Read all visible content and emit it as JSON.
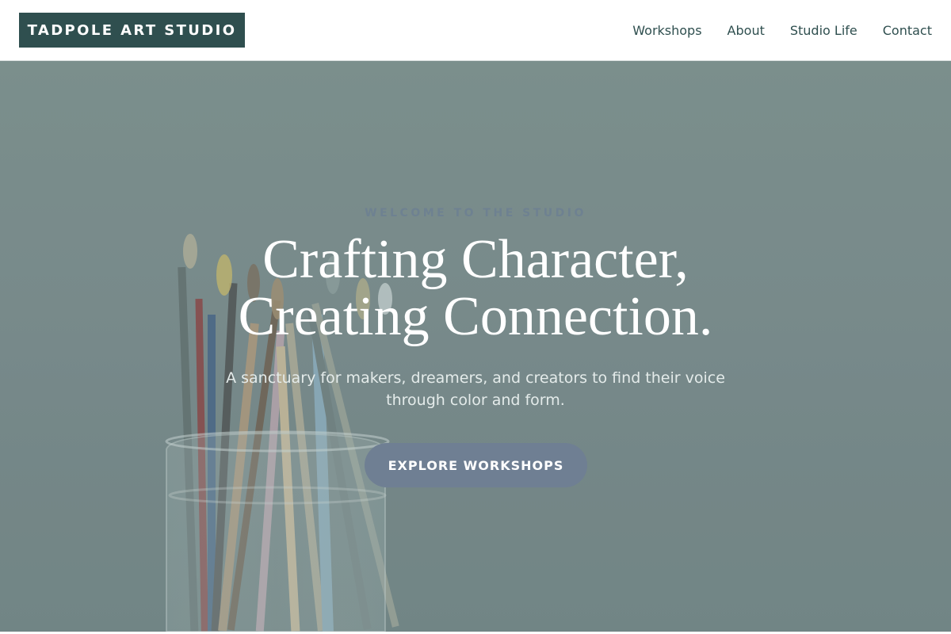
{
  "header": {
    "brand": "TADPOLE ART STUDIO",
    "nav": [
      {
        "label": "Workshops"
      },
      {
        "label": "About"
      },
      {
        "label": "Studio Life"
      },
      {
        "label": "Contact"
      }
    ]
  },
  "hero": {
    "eyebrow": "WELCOME TO THE STUDIO",
    "headline_line1": "Crafting Character,",
    "headline_line2": "Creating Connection.",
    "subtitle_line1": "A sanctuary for makers, dreamers, and creators to find their voice",
    "subtitle_line2": "through color and form.",
    "cta_label": "EXPLORE WORKSHOPS",
    "background_image": "brushes-in-jar-photo"
  },
  "colors": {
    "brand": "#2f4f4f",
    "hero_tint": "#7a8d8c",
    "cta": "#6f7f93",
    "eyebrow": "#6e8191"
  }
}
